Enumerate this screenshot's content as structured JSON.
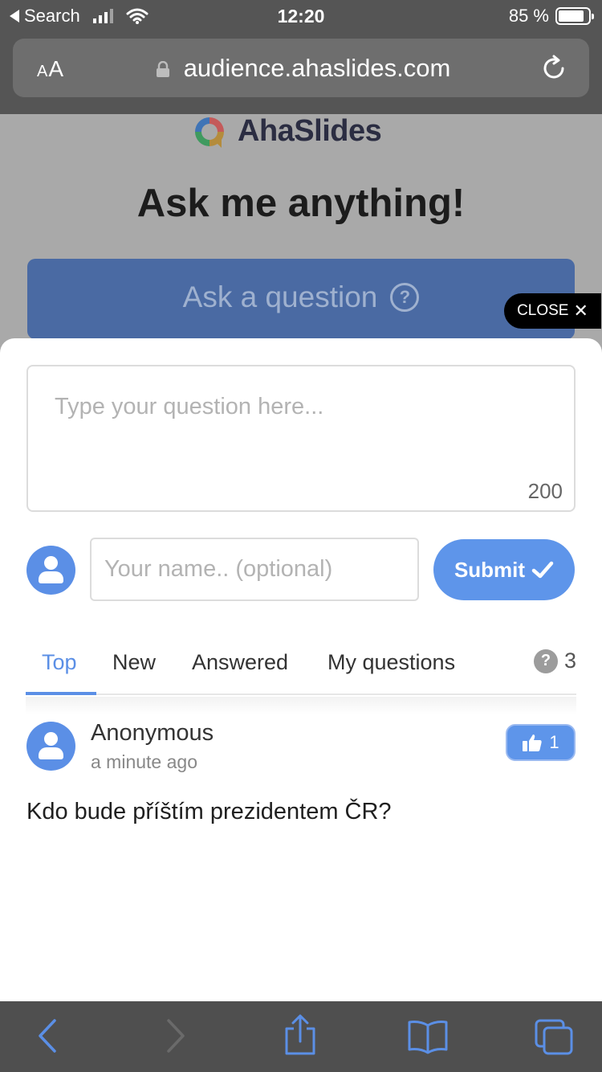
{
  "status_bar": {
    "back_label": "Search",
    "time": "12:20",
    "battery_percent": "85 %",
    "battery_level": 0.85
  },
  "browser": {
    "text_size_label": "AA",
    "url": "audience.ahaslides.com"
  },
  "page": {
    "brand": "AhaSlides",
    "title": "Ask me anything!",
    "ask_button_label": "Ask a question"
  },
  "sheet": {
    "close_label": "CLOSE",
    "question_placeholder": "Type your question here...",
    "char_remaining": "200",
    "name_placeholder": "Your name.. (optional)",
    "submit_label": "Submit",
    "tabs": [
      {
        "label": "Top",
        "active": true
      },
      {
        "label": "New",
        "active": false
      },
      {
        "label": "Answered",
        "active": false
      },
      {
        "label": "My questions",
        "active": false
      }
    ],
    "question_count": "3"
  },
  "questions": [
    {
      "author": "Anonymous",
      "time": "a minute ago",
      "likes": "1",
      "text": "Kdo bude příštím prezidentem ČR?"
    }
  ],
  "colors": {
    "accent": "#5e95ea",
    "ask_button_dimmed": "#4a6aa3",
    "toolbar_icon": "#5b8fe6"
  },
  "icons": [
    "back-arrow-icon",
    "signal-icon",
    "wifi-icon",
    "battery-icon",
    "lock-icon",
    "reload-icon",
    "help-icon",
    "close-icon",
    "user-avatar-icon",
    "check-icon",
    "thumbs-up-icon",
    "share-icon",
    "bookmarks-icon",
    "tabs-icon",
    "forward-arrow-icon"
  ]
}
